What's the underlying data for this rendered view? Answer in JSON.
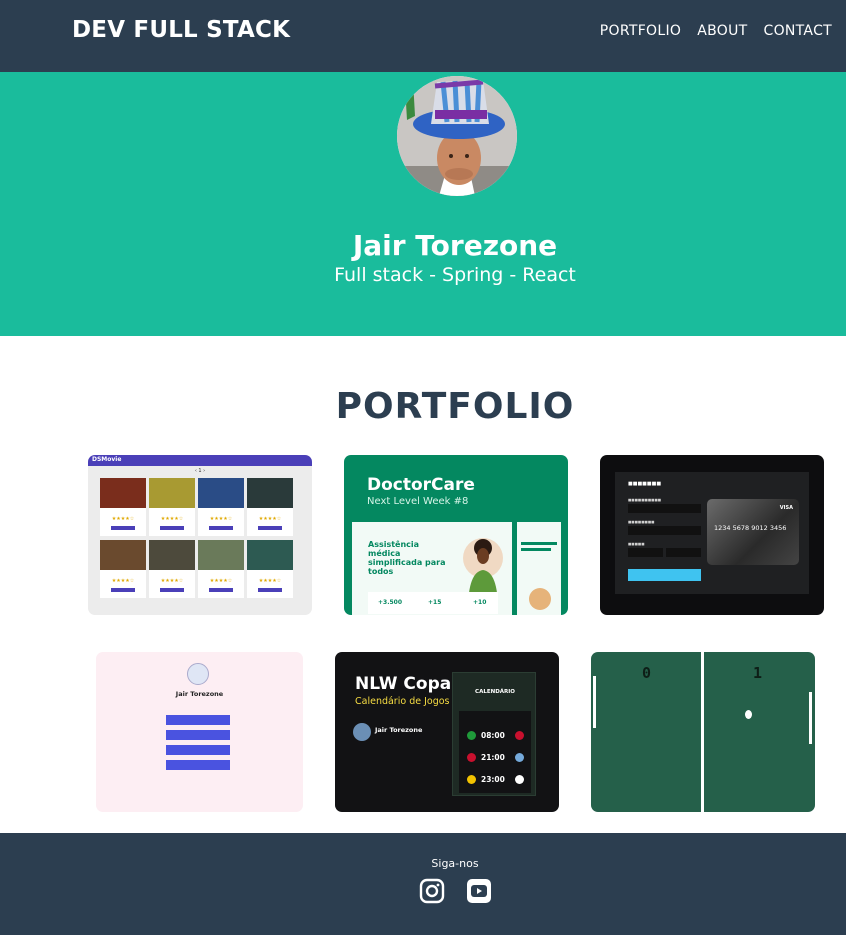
{
  "navbar": {
    "brand": "DEV FULL STACK",
    "links": [
      "PORTFOLIO",
      "ABOUT",
      "CONTACT"
    ]
  },
  "masthead": {
    "name": "Jair Torezone",
    "subtitle": "Full stack - Spring - React"
  },
  "portfolio": {
    "title": "PORTFOLIO",
    "items": [
      {
        "id": "movie-ratings",
        "header": "DSMovie"
      },
      {
        "id": "doctorcare",
        "heading": "DoctorCare",
        "subheading": "Next Level Week #8",
        "hero": "Assistência médica simplificada para todos",
        "stats": [
          "+3.500",
          "+15",
          "+10"
        ]
      },
      {
        "id": "payment-card",
        "card_number": "1234 5678 9012 3456",
        "card_brand": "VISA"
      },
      {
        "id": "link-tree",
        "name": "Jair Torezone"
      },
      {
        "id": "nlw-copa",
        "heading": "NLW Copa",
        "subheading": "Calendário de Jogos",
        "user": "Jair Torezone",
        "calendar": "CALENDÁRIO",
        "times": [
          "08:00",
          "21:00",
          "23:00"
        ]
      },
      {
        "id": "pong-game",
        "score_left": "0",
        "score_right": "1"
      }
    ]
  },
  "footer": {
    "follow_label": "Siga-nos",
    "icons": [
      "instagram-icon",
      "youtube-icon"
    ]
  },
  "colors": {
    "navbar": "#2c3e50",
    "masthead": "#1abc9c",
    "title": "#2c3e50"
  }
}
